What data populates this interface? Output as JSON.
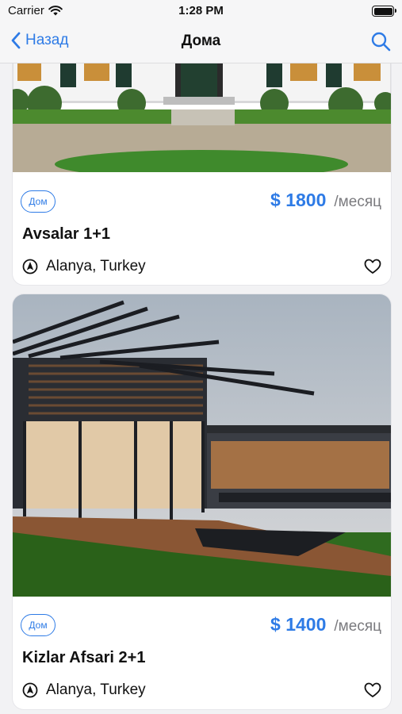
{
  "status_bar": {
    "carrier": "Carrier",
    "time": "1:28 PM"
  },
  "nav": {
    "back_label": "Назад",
    "title": "Дома"
  },
  "listings": [
    {
      "type_badge": "Дом",
      "price": "$ 1800",
      "price_unit": "/месяц",
      "title": "Avsalar 1+1",
      "location": "Alanya, Turkey"
    },
    {
      "type_badge": "Дом",
      "price": "$ 1400",
      "price_unit": "/месяц",
      "title": "Kizlar Afsari 2+1",
      "location": "Alanya, Turkey"
    }
  ],
  "colors": {
    "accent": "#2e7be6",
    "muted": "#7a7a7e"
  },
  "icons": [
    "wifi-icon",
    "battery-icon",
    "chevron-left-icon",
    "search-icon",
    "location-arrow-icon",
    "heart-icon"
  ]
}
